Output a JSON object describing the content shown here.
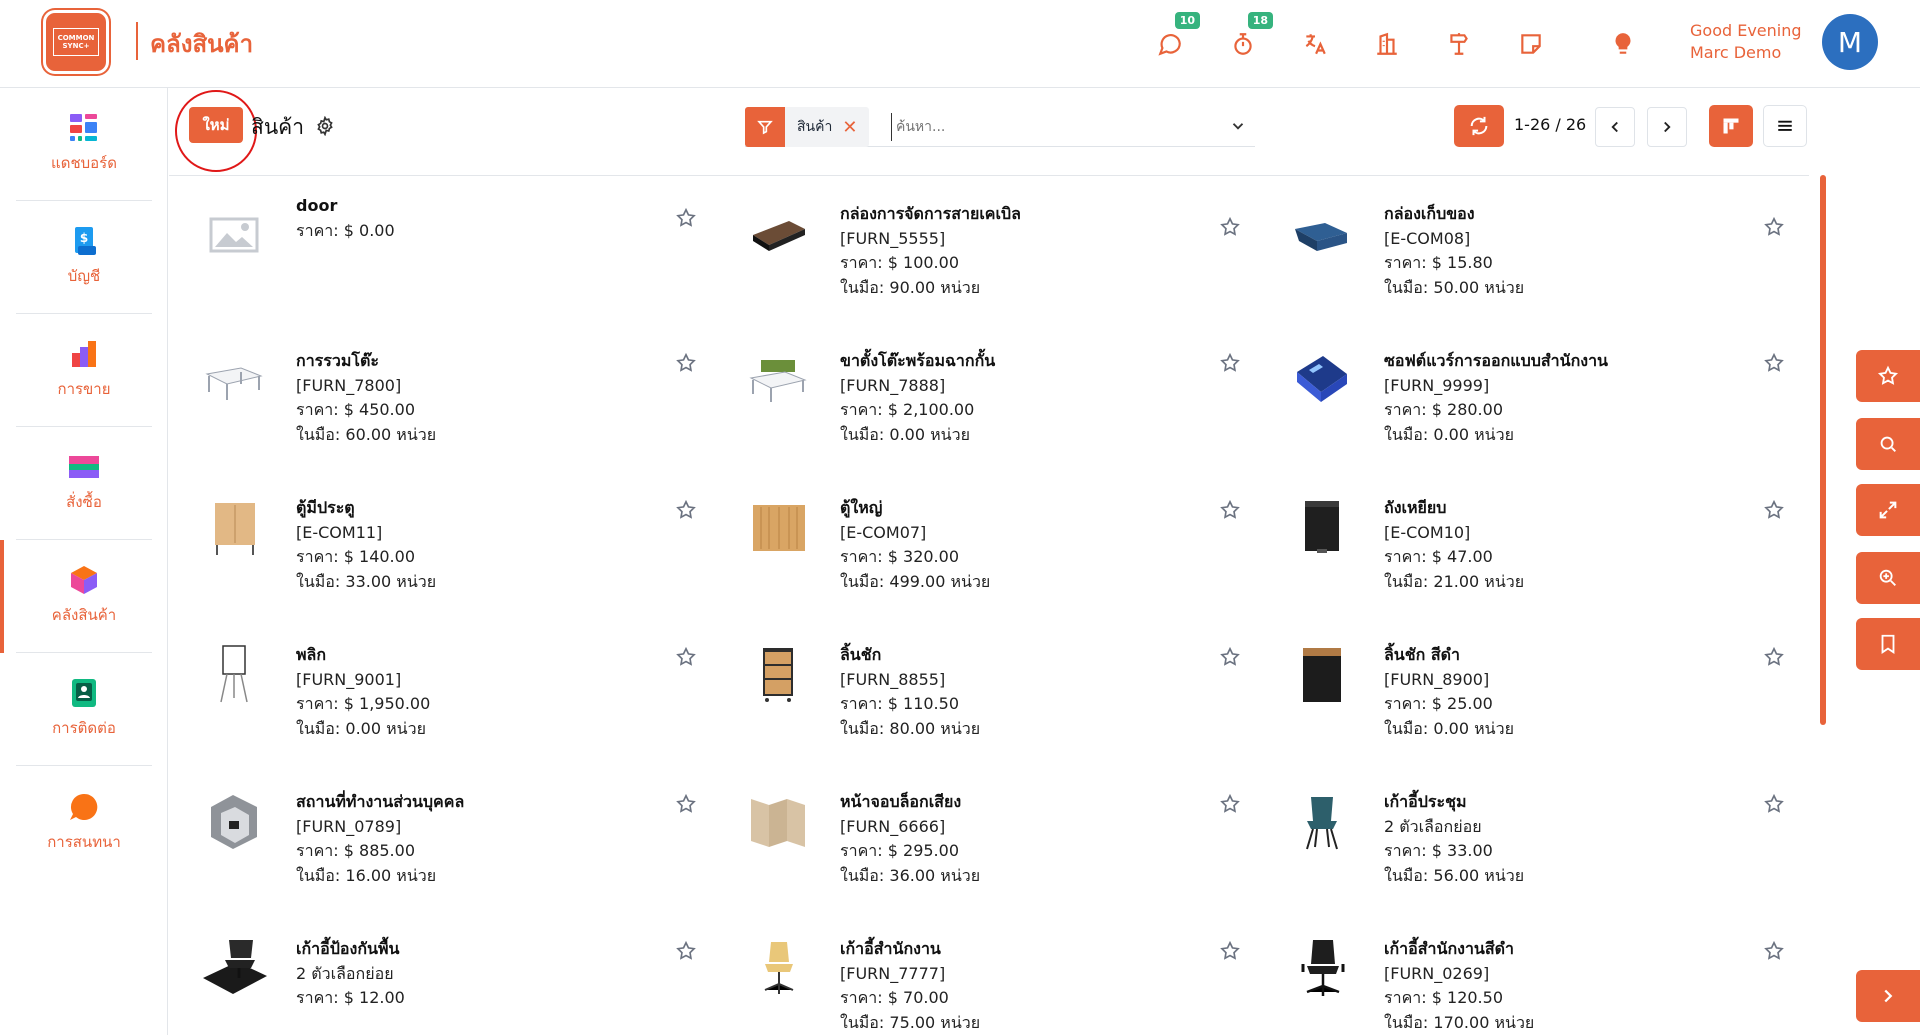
{
  "header": {
    "app_title": "คลังสินค้า",
    "logo_text_1": "COMMON",
    "logo_text_2": "SYNC+",
    "messages_badge": "10",
    "activities_badge": "18",
    "greeting_line1": "Good Evening",
    "greeting_line2": "Marc Demo",
    "avatar_letter": "M"
  },
  "sidebar": {
    "items": [
      {
        "label": "แดชบอร์ด",
        "icon": "dashboard-icon"
      },
      {
        "label": "บัญชี",
        "icon": "accounting-icon"
      },
      {
        "label": "การขาย",
        "icon": "sales-icon"
      },
      {
        "label": "สั่งซื้อ",
        "icon": "purchase-icon"
      },
      {
        "label": "คลังสินค้า",
        "icon": "inventory-icon",
        "active": true
      },
      {
        "label": "การติดต่อ",
        "icon": "contacts-icon"
      },
      {
        "label": "การสนทนา",
        "icon": "discuss-icon"
      }
    ]
  },
  "control_panel": {
    "new_button": "ใหม่",
    "breadcrumb": "สินค้า",
    "facet_label": "สินค้า",
    "search_placeholder": "ค้นหา...",
    "pager_value": "1-26 / 26"
  },
  "products": [
    {
      "name": "door",
      "ref": "",
      "price": "ราคา: $ 0.00",
      "onhand": ""
    },
    {
      "name": "กล่องการจัดการสายเคเบิล",
      "ref": "[FURN_5555]",
      "price": "ราคา: $ 100.00",
      "onhand": "ในมือ: 90.00 หน่วย"
    },
    {
      "name": "กล่องเก็บของ",
      "ref": "[E-COM08]",
      "price": "ราคา: $ 15.80",
      "onhand": "ในมือ: 50.00 หน่วย"
    },
    {
      "name": "การรวมโต๊ะ",
      "ref": "[FURN_7800]",
      "price": "ราคา: $ 450.00",
      "onhand": "ในมือ: 60.00 หน่วย"
    },
    {
      "name": "ขาตั้งโต๊ะพร้อมฉากกั้น",
      "ref": "[FURN_7888]",
      "price": "ราคา: $ 2,100.00",
      "onhand": "ในมือ: 0.00 หน่วย"
    },
    {
      "name": "ซอฟต์แวร์การออกแบบสำนักงาน",
      "ref": "[FURN_9999]",
      "price": "ราคา: $ 280.00",
      "onhand": "ในมือ: 0.00 หน่วย"
    },
    {
      "name": "ตู้มีประตู",
      "ref": "[E-COM11]",
      "price": "ราคา: $ 140.00",
      "onhand": "ในมือ: 33.00 หน่วย"
    },
    {
      "name": "ตู้ใหญ่",
      "ref": "[E-COM07]",
      "price": "ราคา: $ 320.00",
      "onhand": "ในมือ: 499.00 หน่วย"
    },
    {
      "name": "ถังเหยียบ",
      "ref": "[E-COM10]",
      "price": "ราคา: $ 47.00",
      "onhand": "ในมือ: 21.00 หน่วย"
    },
    {
      "name": "พลิก",
      "ref": "[FURN_9001]",
      "price": "ราคา: $ 1,950.00",
      "onhand": "ในมือ: 0.00 หน่วย"
    },
    {
      "name": "ลิ้นชัก",
      "ref": "[FURN_8855]",
      "price": "ราคา: $ 110.50",
      "onhand": "ในมือ: 80.00 หน่วย"
    },
    {
      "name": "ลิ้นชัก สีดำ",
      "ref": "[FURN_8900]",
      "price": "ราคา: $ 25.00",
      "onhand": "ในมือ: 0.00 หน่วย"
    },
    {
      "name": "สถานที่ทำงานส่วนบุคคล",
      "ref": "[FURN_0789]",
      "price": "ราคา: $ 885.00",
      "onhand": "ในมือ: 16.00 หน่วย"
    },
    {
      "name": "หน้าจอบล็อกเสียง",
      "ref": "[FURN_6666]",
      "price": "ราคา: $ 295.00",
      "onhand": "ในมือ: 36.00 หน่วย"
    },
    {
      "name": "เก้าอี้ประชุม",
      "ref": "2 ตัวเลือกย่อย",
      "price": "ราคา: $ 33.00",
      "onhand": "ในมือ: 56.00 หน่วย"
    },
    {
      "name": "เก้าอี้ป้องกันพื้น",
      "ref": "2 ตัวเลือกย่อย",
      "price": "ราคา: $ 12.00",
      "onhand": ""
    },
    {
      "name": "เก้าอี้สำนักงาน",
      "ref": "[FURN_7777]",
      "price": "ราคา: $ 70.00",
      "onhand": "ในมือ: 75.00 หน่วย"
    },
    {
      "name": "เก้าอี้สำนักงานสีดำ",
      "ref": "[FURN_0269]",
      "price": "ราคา: $ 120.50",
      "onhand": "ในมือ: 170.00 หน่วย"
    }
  ],
  "colors": {
    "accent": "#e8633a",
    "badge": "#36b37e",
    "avatar": "#2c6fbf",
    "highlight_circle": "#e01818"
  }
}
